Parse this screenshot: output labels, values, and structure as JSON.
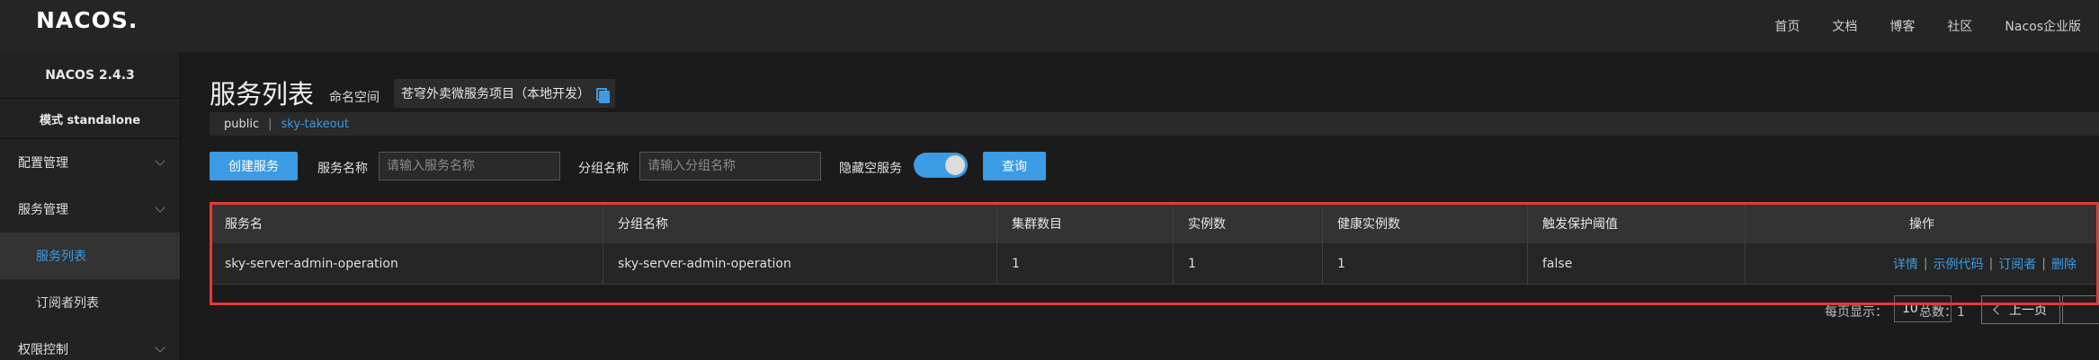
{
  "app": {
    "logo": "NACOS."
  },
  "topnav": [
    "首页",
    "文档",
    "博客",
    "社区",
    "Nacos企业版"
  ],
  "sidebar": {
    "version": "NACOS 2.4.3",
    "mode": "模式 standalone",
    "items": [
      {
        "label": "配置管理",
        "type": "group"
      },
      {
        "label": "服务管理",
        "type": "group"
      },
      {
        "label": "服务列表",
        "type": "sub",
        "active": true
      },
      {
        "label": "订阅者列表",
        "type": "sub"
      },
      {
        "label": "权限控制",
        "type": "group"
      }
    ]
  },
  "page": {
    "title": "服务列表",
    "namespace_label": "命名空间",
    "namespace_value": "苍穹外卖微服务项目（本地开发）",
    "namespaces": {
      "public": "public",
      "separator": "|",
      "custom": "sky-takeout"
    }
  },
  "filters": {
    "create_button": "创建服务",
    "service_name_label": "服务名称",
    "service_name_placeholder": "请输入服务名称",
    "group_name_label": "分组名称",
    "group_name_placeholder": "请输入分组名称",
    "hide_empty_label": "隐藏空服务",
    "hide_empty_on": true,
    "query_button": "查询"
  },
  "table": {
    "columns": [
      "服务名",
      "分组名称",
      "集群数目",
      "实例数",
      "健康实例数",
      "触发保护阈值",
      "操作"
    ],
    "rows": [
      {
        "service": "sky-server-admin-operation",
        "group": "sky-server-admin-operation",
        "clusters": "1",
        "instances": "1",
        "healthy": "1",
        "threshold": "false",
        "ops": [
          "详情",
          "示例代码",
          "订阅者",
          "删除"
        ]
      }
    ]
  },
  "pagination": {
    "page_size_label": "每页显示：",
    "page_size": "10",
    "total_label": "总数：1",
    "prev_label": "上一页"
  },
  "colors": {
    "accent": "#3b9be4",
    "highlight": "#e53935"
  }
}
